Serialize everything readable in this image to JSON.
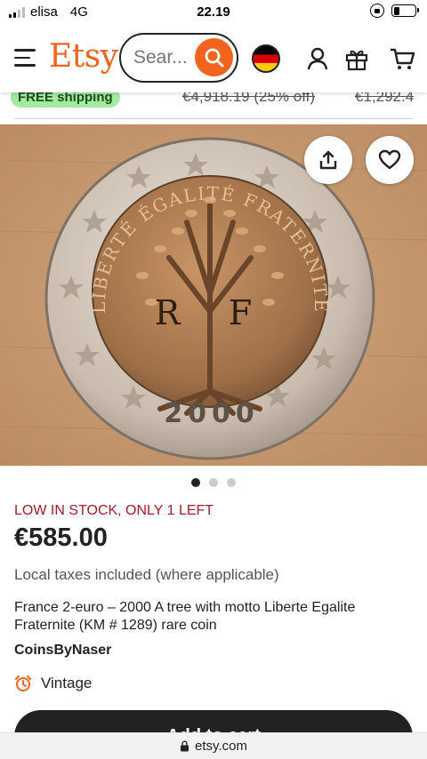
{
  "status_bar": {
    "carrier": "elisa",
    "network": "4G",
    "time": "22.19"
  },
  "header": {
    "logo": "Etsy",
    "search_placeholder": "Sear...",
    "icons": [
      "menu-icon",
      "search-icon",
      "germany-flag-icon",
      "account-icon",
      "gift-icon",
      "cart-icon"
    ]
  },
  "prev_strip": {
    "badge": "FREE shipping",
    "price_1": "€4,918.19 (25% off)",
    "price_2": "€1,292.4"
  },
  "product": {
    "stock_notice": "LOW IN STOCK, ONLY 1 LEFT",
    "price": "€585.00",
    "tax_note": "Local taxes included (where applicable)",
    "title": "France 2-euro – 2000 A tree with motto Liberte Egalite Fraternite (KM # 1289) rare coin",
    "shop_name": "CoinsByNaser",
    "tag": "Vintage"
  },
  "coin": {
    "motto": "LIBERTÉ ÉGALITÉ FRATERNITÉ",
    "initial_left": "R",
    "initial_right": "F",
    "year": "2000"
  },
  "carousel": {
    "dots": 3,
    "active": 0
  },
  "actions": {
    "add_to_cart": "Add to cart"
  },
  "browser": {
    "url": "etsy.com"
  },
  "colors": {
    "brand": "#f1641e",
    "stock_red": "#a61a2e",
    "free_ship_bg": "#a3e8a3"
  }
}
